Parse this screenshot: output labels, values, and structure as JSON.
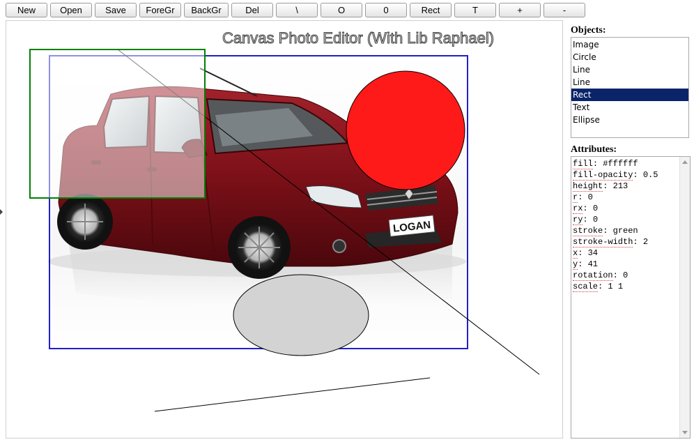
{
  "toolbar": {
    "buttons": [
      {
        "id": "new",
        "label": "New"
      },
      {
        "id": "open",
        "label": "Open"
      },
      {
        "id": "save",
        "label": "Save"
      },
      {
        "id": "foregr",
        "label": "ForeGr"
      },
      {
        "id": "backgr",
        "label": "BackGr"
      },
      {
        "id": "del",
        "label": "Del"
      },
      {
        "id": "line",
        "label": "\\"
      },
      {
        "id": "circle",
        "label": "O"
      },
      {
        "id": "ellipse",
        "label": "0"
      },
      {
        "id": "rect",
        "label": "Rect"
      },
      {
        "id": "text",
        "label": "T"
      },
      {
        "id": "zoom-in",
        "label": "+"
      },
      {
        "id": "zoom-out",
        "label": "-"
      }
    ]
  },
  "canvas": {
    "title_text": "Canvas Photo Editor (With Lib Raphael)",
    "colors": {
      "frame_stroke": "#1f1fc8",
      "rect_stroke": "green",
      "circle_fill": "#ff1a1a",
      "ellipse_fill": "#d3d3d3",
      "car_body": "#7c1018"
    },
    "plate_text": "LOGAN"
  },
  "objects": {
    "title": "Objects:",
    "items": [
      {
        "label": "Image",
        "selected": false
      },
      {
        "label": "Circle",
        "selected": false
      },
      {
        "label": "Line",
        "selected": false
      },
      {
        "label": "Line",
        "selected": false
      },
      {
        "label": "Rect",
        "selected": true
      },
      {
        "label": "Text",
        "selected": false
      },
      {
        "label": "Ellipse",
        "selected": false
      }
    ]
  },
  "attributes": {
    "title": "Attributes:",
    "rows": [
      {
        "key": "fill",
        "value": "#ffffff"
      },
      {
        "key": "fill-opacity",
        "value": "0.5"
      },
      {
        "key": "height",
        "value": "213"
      },
      {
        "key": "r",
        "value": "0"
      },
      {
        "key": "rx",
        "value": "0"
      },
      {
        "key": "ry",
        "value": "0"
      },
      {
        "key": "stroke",
        "value": "green"
      },
      {
        "key": "stroke-width",
        "value": "2"
      },
      {
        "key": "x",
        "value": "34"
      },
      {
        "key": "y",
        "value": "41"
      },
      {
        "key": "rotation",
        "value": "0"
      },
      {
        "key": "scale",
        "value": "1 1"
      }
    ]
  }
}
